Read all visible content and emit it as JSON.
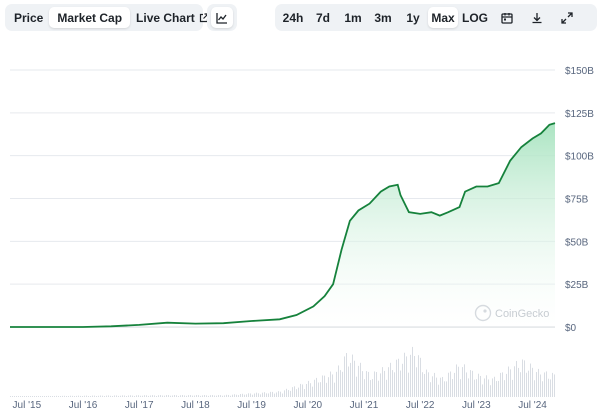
{
  "toolbar": {
    "tabs": [
      {
        "label": "Price",
        "active": false
      },
      {
        "label": "Market Cap",
        "active": true
      },
      {
        "label": "Live Chart",
        "active": false
      }
    ],
    "chart_type_icon": "line-chart-icon",
    "ranges": [
      {
        "label": "24h",
        "active": false
      },
      {
        "label": "7d",
        "active": false
      },
      {
        "label": "1m",
        "active": false
      },
      {
        "label": "3m",
        "active": false
      },
      {
        "label": "1y",
        "active": false
      },
      {
        "label": "Max",
        "active": true
      }
    ],
    "log_label": "LOG",
    "icons": [
      "calendar-icon",
      "download-icon",
      "expand-icon"
    ]
  },
  "watermark": "CoinGecko",
  "colors": {
    "line": "#16a34a",
    "fill_top": "#a7e3bf",
    "grid": "#e6e9ee",
    "volume": "#d9dde3"
  },
  "chart_data": {
    "type": "area",
    "title": "",
    "xlabel": "",
    "ylabel": "",
    "x_ticks": [
      "Jul '15",
      "Jul '16",
      "Jul '17",
      "Jul '18",
      "Jul '19",
      "Jul '20",
      "Jul '21",
      "Jul '22",
      "Jul '23",
      "Jul '24"
    ],
    "y_ticks": [
      "$0",
      "$25B",
      "$50B",
      "$75B",
      "$100B",
      "$125B",
      "$150B"
    ],
    "ylim": [
      0,
      150
    ],
    "y_unit": "B USD",
    "xlim": [
      2015.2,
      2024.9
    ],
    "grid": true,
    "series": [
      {
        "values": [
          [
            2015.2,
            0
          ],
          [
            2016.5,
            0
          ],
          [
            2017.0,
            0.4
          ],
          [
            2017.5,
            1.2
          ],
          [
            2018.0,
            2.5
          ],
          [
            2018.5,
            2.0
          ],
          [
            2019.0,
            2.2
          ],
          [
            2019.5,
            3.5
          ],
          [
            2020.0,
            4.5
          ],
          [
            2020.3,
            7
          ],
          [
            2020.6,
            12
          ],
          [
            2020.8,
            18
          ],
          [
            2020.95,
            25
          ],
          [
            2021.1,
            45
          ],
          [
            2021.25,
            62
          ],
          [
            2021.4,
            68
          ],
          [
            2021.6,
            72
          ],
          [
            2021.8,
            79
          ],
          [
            2021.95,
            82
          ],
          [
            2022.1,
            83
          ],
          [
            2022.15,
            77
          ],
          [
            2022.3,
            67
          ],
          [
            2022.5,
            66
          ],
          [
            2022.7,
            67
          ],
          [
            2022.85,
            65
          ],
          [
            2023.0,
            67
          ],
          [
            2023.2,
            70
          ],
          [
            2023.3,
            79
          ],
          [
            2023.5,
            82
          ],
          [
            2023.7,
            82
          ],
          [
            2023.9,
            84
          ],
          [
            2024.1,
            97
          ],
          [
            2024.3,
            105
          ],
          [
            2024.5,
            110
          ],
          [
            2024.65,
            113
          ],
          [
            2024.8,
            118
          ],
          [
            2024.9,
            119
          ]
        ]
      }
    ],
    "volume": [
      [
        2015.2,
        0.2
      ],
      [
        2017.0,
        0.4
      ],
      [
        2018.0,
        0.5
      ],
      [
        2019.0,
        0.5
      ],
      [
        2020.0,
        1.5
      ],
      [
        2020.5,
        4
      ],
      [
        2021.0,
        7
      ],
      [
        2021.2,
        12
      ],
      [
        2021.4,
        9
      ],
      [
        2021.6,
        6
      ],
      [
        2021.9,
        8
      ],
      [
        2022.1,
        10
      ],
      [
        2022.4,
        13
      ],
      [
        2022.6,
        7
      ],
      [
        2022.9,
        5
      ],
      [
        2023.2,
        9
      ],
      [
        2023.5,
        6
      ],
      [
        2023.8,
        5
      ],
      [
        2024.1,
        8
      ],
      [
        2024.3,
        10
      ],
      [
        2024.6,
        7
      ],
      [
        2024.9,
        6
      ]
    ]
  }
}
